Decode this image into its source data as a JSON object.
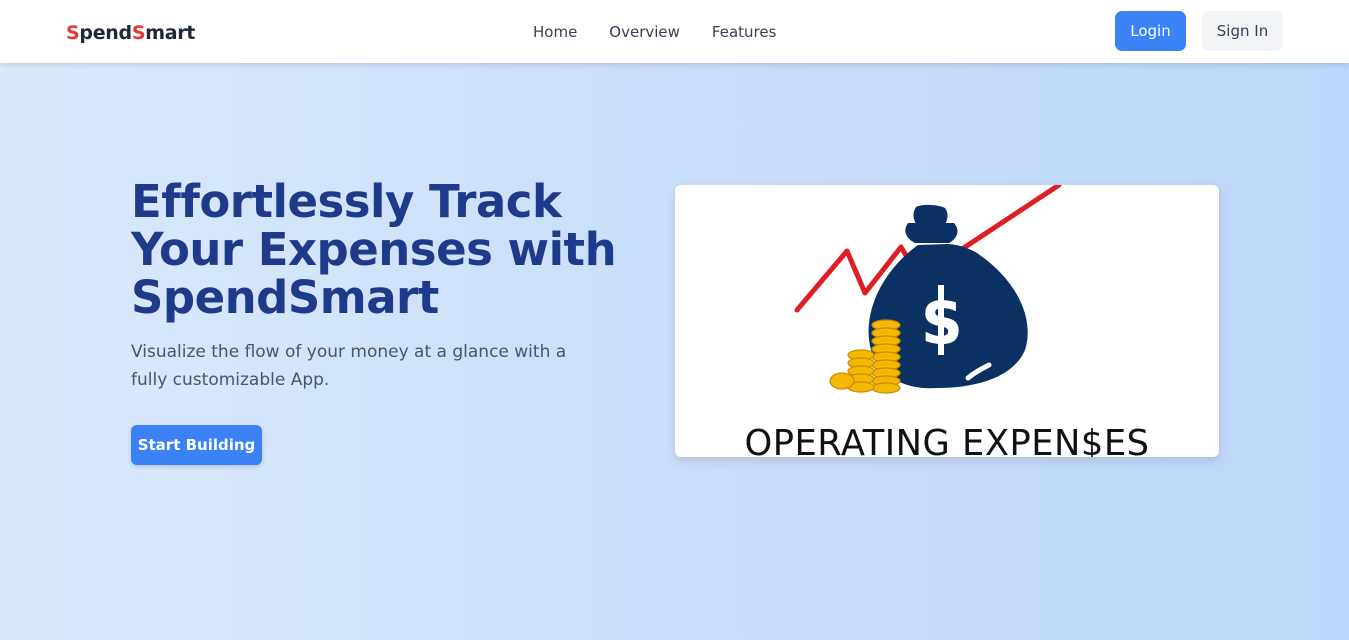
{
  "brand": {
    "prefix_s": "S",
    "part1": "pend",
    "mid_s": "S",
    "part2": "mart"
  },
  "nav": {
    "links": [
      "Home",
      "Overview",
      "Features"
    ],
    "login_label": "Login",
    "signin_label": "Sign In"
  },
  "hero": {
    "title": "Effortlessly Track Your Expenses with SpendSmart",
    "subtitle": "Visualize the flow of your money at a glance with a fully customizable App.",
    "cta_label": "Start Building",
    "image_caption": "OPERATING EXPEN$ES"
  },
  "colors": {
    "brand_accent": "#e53935",
    "primary": "#3b82f6",
    "heading": "#1e3a8a",
    "bag": "#0b3162",
    "trend_line": "#e11d24",
    "coin": "#f5b800"
  },
  "icons": [
    "money-bag-icon",
    "trend-arrow-icon",
    "coin-stack-icon"
  ]
}
